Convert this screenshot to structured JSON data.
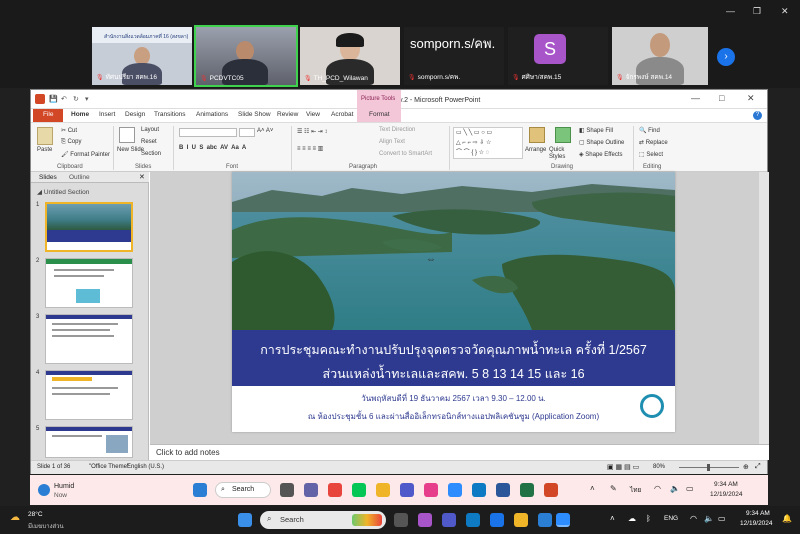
{
  "meeting": {
    "participants": [
      {
        "name": "ทัศนปรียา สคพ.16",
        "muted": true
      },
      {
        "name": "PCDVTC05",
        "muted": true
      },
      {
        "name": "TH_PCD_Wilawan",
        "muted": true
      },
      {
        "name": "somporn.s/คพ.",
        "muted": true,
        "label": "somporn.s/คพ."
      },
      {
        "name": "ศศิษา/สคพ.15",
        "muted": true,
        "initial": "S"
      },
      {
        "name": "จักรพงษ์ สคพ.14",
        "muted": true
      }
    ],
    "tile1_banner": "สำนักงานสิ่งแวดล้อมภาคที่ 16 (สงขลา)"
  },
  "ppt": {
    "window_title": "ptt_19ธค67 v.2 - Microsoft PowerPoint",
    "context_tab": "Picture Tools",
    "tabs": [
      "File",
      "Home",
      "Insert",
      "Design",
      "Transitions",
      "Animations",
      "Slide Show",
      "Review",
      "View",
      "Acrobat",
      "Format"
    ],
    "ribbon": {
      "paste": "Paste",
      "cut": "Cut",
      "copy": "Copy",
      "format_painter": "Format Painter",
      "clipboard": "Clipboard",
      "new_slide": "New Slide",
      "layout": "Layout",
      "reset": "Reset",
      "section": "Section",
      "slides": "Slides",
      "font": "Font",
      "text_direction": "Text Direction",
      "align_text": "Align Text",
      "convert_smartart": "Convert to SmartArt",
      "paragraph": "Paragraph",
      "arrange": "Arrange",
      "quick_styles": "Quick Styles",
      "shape_fill": "Shape Fill",
      "shape_outline": "Shape Outline",
      "shape_effects": "Shape Effects",
      "drawing": "Drawing",
      "find": "Find",
      "replace": "Replace",
      "select": "Select",
      "editing": "Editing"
    },
    "pane_tabs": {
      "slides": "Slides",
      "outline": "Outline"
    },
    "section_name": "Untitled Section",
    "thumb_numbers": [
      "1",
      "2",
      "3",
      "4",
      "5"
    ],
    "slide": {
      "title_line1": "การประชุมคณะทำงานปรับปรุงจุดตรวจวัดคุณภาพน้ำทะเล ครั้งที่ 1/2567",
      "title_line2": "ส่วนแหล่งน้ำทะเลและสคพ. 5 8 13 14 15 และ 16",
      "date_line": "วันพฤหัสบดีที่ 19 ธันวาคม 2567 เวลา 9.30 – 12.00 น.",
      "venue_line": "ณ ห้องประชุมชั้น 6 และผ่านสื่ออิเล็กทรอนิกส์ทางแอปพลิเคชันซูม (Application Zoom)"
    },
    "notes_placeholder": "Click to add notes",
    "status": {
      "slide_count": "Slide 1 of 36",
      "theme": "\"Office Theme\"",
      "language": "English (U.S.)",
      "zoom": "80%"
    }
  },
  "remote_taskbar": {
    "weather_title": "Humid",
    "weather_sub": "Now",
    "search": "Search",
    "lang": "ไทย",
    "time": "9:34 AM",
    "date": "12/19/2024"
  },
  "local_taskbar": {
    "temp": "28°C",
    "weather_desc": "มีเมฆบางส่วน",
    "search_placeholder": "Search",
    "lang": "ENG",
    "time": "9:34 AM",
    "date": "12/19/2024"
  }
}
